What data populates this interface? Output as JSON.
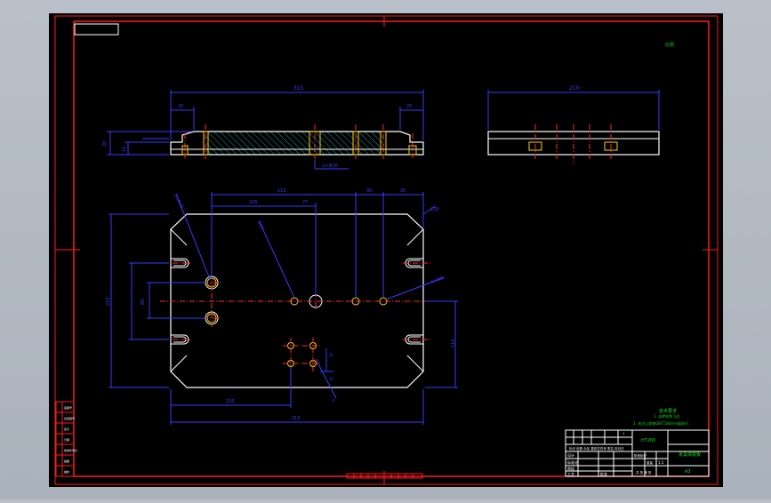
{
  "colors": {
    "background": "#000000",
    "frame": "#ff1a1a",
    "outline": "#ffffff",
    "dimension": "#3a3aff",
    "center": "#ff2a2a",
    "hatch": "#11c7c7",
    "note": "#19d919",
    "chrome": "#b3bac3"
  },
  "labels": {
    "scale_note": "比例",
    "top_overall": "315",
    "top_left_step": "25",
    "top_right_step": "25",
    "top_height": "20",
    "top_step_height": "10",
    "top_bottom_note": "2×Φ16",
    "side_overall": "210",
    "plan_top_a": "110",
    "plan_top_b": "105",
    "plan_top_c": "77",
    "plan_top_d": "30",
    "plan_top_e": "30",
    "plan_right_chamfer": "C20",
    "plan_height": "210",
    "plan_inner_height": "80",
    "plan_right_height": "110",
    "plan_bottom_a": "150",
    "plan_bottom_total": "315",
    "leader_a": "2×Φ16",
    "leader_b": "Φ13",
    "leader_c": "4×Φ8",
    "leader_d": "20",
    "leader_e": "30",
    "leader_f": "6"
  },
  "notes": {
    "title": "技术要求",
    "line1": "1. 去除毛刺飞边.",
    "line2": "2. 未注公差按GB/T1804-m级执行."
  },
  "title_block": {
    "material": "HT200",
    "part_name": "夹具体底板",
    "drawing_no": "A3",
    "scale": "1:1",
    "sheet": "1",
    "header": "标记 处数 分区 更改文件号 签名 年月日",
    "designer": "设计",
    "checker": "审核",
    "standard": "标准化",
    "process": "工艺",
    "approve": "批准",
    "weight": "重量",
    "stage": "阶段标记",
    "count": "共 张 第 张"
  },
  "side_tabs": [
    "底图号",
    "旧底图号",
    "签字",
    "日期",
    "借用件登记",
    "描图",
    "描校"
  ]
}
